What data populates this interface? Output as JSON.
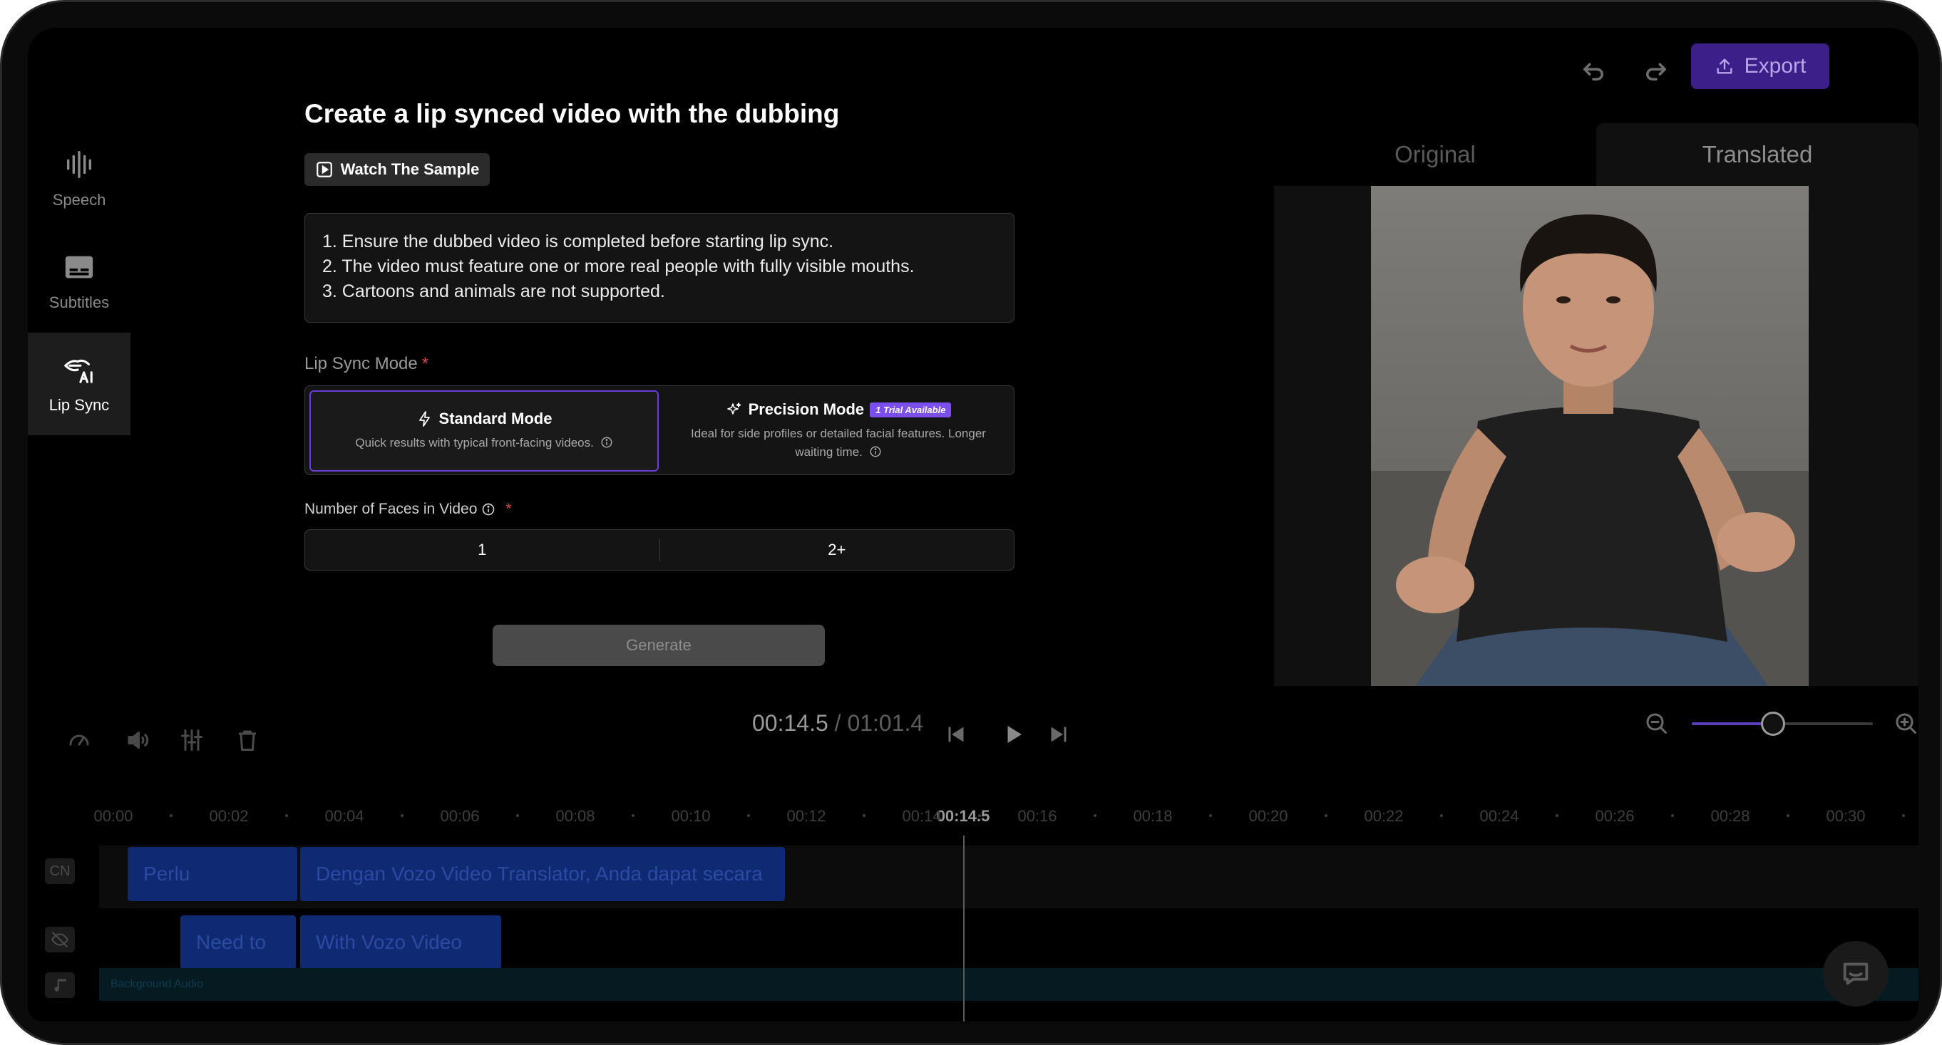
{
  "sidebar": {
    "items": [
      {
        "label": "Speech",
        "icon": "waveform-icon",
        "active": false
      },
      {
        "label": "Subtitles",
        "icon": "subtitles-icon",
        "active": false
      },
      {
        "label": "Lip Sync",
        "icon": "ai-lips-icon",
        "active": true
      }
    ]
  },
  "toolbar": {
    "export_label": "Export",
    "accent": "#3d1f8a"
  },
  "panel": {
    "title": "Create a lip synced video with the dubbing",
    "watch_sample_label": "Watch The Sample",
    "rules": [
      "1. Ensure the dubbed video is completed before starting lip sync.",
      "2. The video must feature one or more real people with fully visible mouths.",
      "3. Cartoons and animals are not supported."
    ],
    "lip_sync_mode_label": "Lip Sync Mode",
    "required_mark": "*",
    "modes": {
      "standard": {
        "title": "Standard Mode",
        "desc": "Quick results with typical front-facing videos.",
        "selected": true
      },
      "precision": {
        "title": "Precision Mode",
        "badge": "1 Trial Available",
        "desc": "Ideal for side profiles or detailed facial features. Longer waiting time.",
        "selected": false
      }
    },
    "faces_label": "Number of Faces in Video",
    "faces_options": [
      "1",
      "2+"
    ],
    "generate_label": "Generate"
  },
  "preview": {
    "tabs": [
      "Original",
      "Translated"
    ],
    "active_tab": "Translated"
  },
  "player": {
    "current_time": "00:14.5",
    "separator": " / ",
    "duration": "01:01.4",
    "zoom_level": 0.45
  },
  "timeline": {
    "ticks": [
      "00:00",
      "00:02",
      "00:04",
      "00:06",
      "00:08",
      "00:10",
      "00:12",
      "00:14",
      "00:16",
      "00:18",
      "00:20",
      "00:22",
      "00:24",
      "00:26",
      "00:28",
      "00:30"
    ],
    "current_label": "00:14.5",
    "tracks": {
      "cn": {
        "tag": "CN",
        "clips": [
          "Perlu",
          "Dengan Vozo Video Translator, Anda dapat secara"
        ]
      },
      "original": {
        "tag_icon": "eye-off-icon",
        "clips": [
          "Need to",
          "With Vozo Video"
        ]
      },
      "background": {
        "tag_icon": "music-note-icon",
        "label": "Background Audio"
      }
    }
  }
}
